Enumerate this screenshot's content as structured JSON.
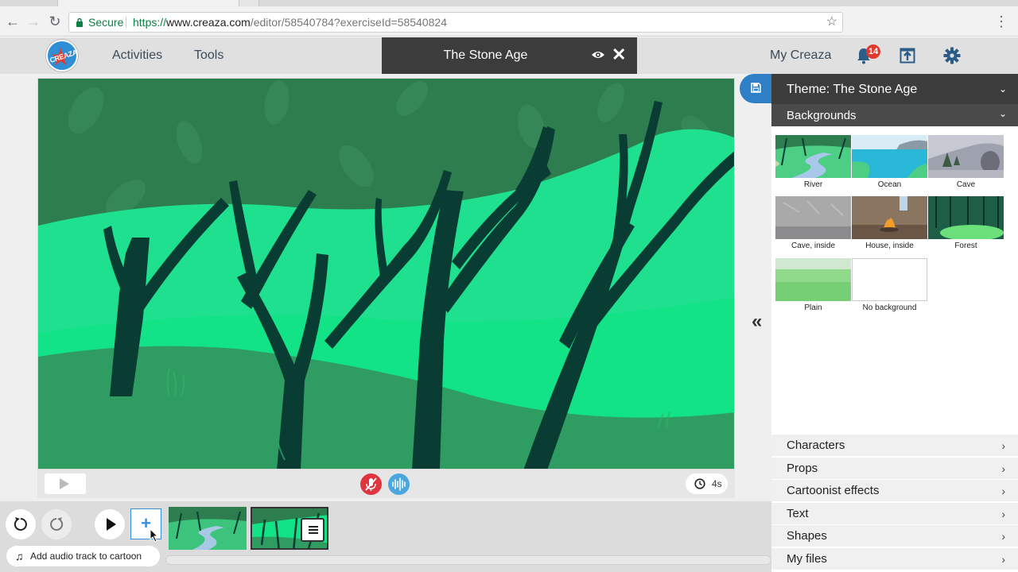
{
  "browser": {
    "secure_label": "Secure",
    "url_scheme": "https://",
    "url_host": "www.creaza.com",
    "url_path": "/editor/58540784?exerciseId=58540824"
  },
  "header": {
    "logo_text": "CREAZA",
    "nav": [
      {
        "label": "Activities"
      },
      {
        "label": "Tools"
      }
    ],
    "project_title": "The Stone Age",
    "my_creaza": "My Creaza",
    "notification_count": "14"
  },
  "stage": {
    "duration": "4s"
  },
  "timeline": {
    "add_audio_label": "Add audio track to cartoon",
    "add_scene_symbol": "+"
  },
  "panel": {
    "theme_label": "Theme: The Stone Age",
    "backgrounds_label": "Backgrounds",
    "backgrounds": [
      {
        "label": "River"
      },
      {
        "label": "Ocean"
      },
      {
        "label": "Cave"
      },
      {
        "label": "Cave, inside"
      },
      {
        "label": "House, inside"
      },
      {
        "label": "Forest"
      },
      {
        "label": "Plain"
      },
      {
        "label": "No background"
      }
    ],
    "categories": [
      {
        "label": "Characters"
      },
      {
        "label": "Props"
      },
      {
        "label": "Cartoonist effects"
      },
      {
        "label": "Text"
      },
      {
        "label": "Shapes"
      },
      {
        "label": "My files"
      }
    ]
  },
  "colors": {
    "accent_blue": "#2f7fc7",
    "dark_bar": "#3c3c3c",
    "forest_dark": "#2e7d4f",
    "grass_bright": "#11e386",
    "tree": "#093d34",
    "badge_red": "#e03a2f"
  }
}
